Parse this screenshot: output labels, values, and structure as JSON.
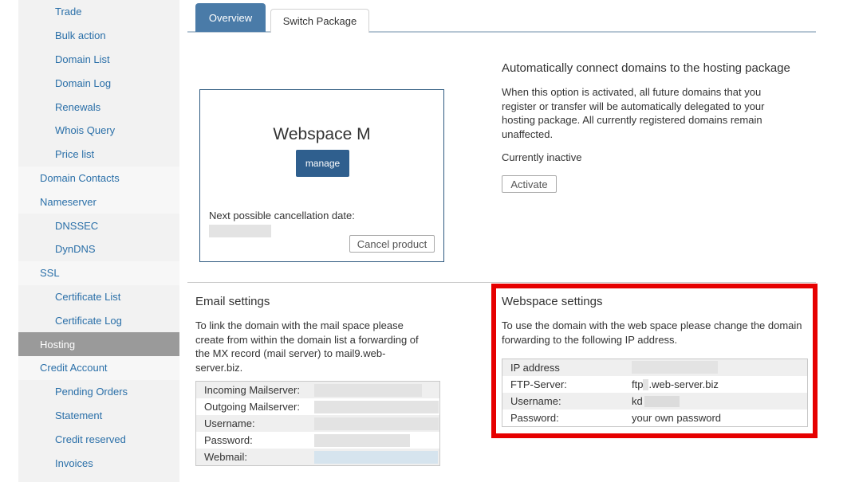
{
  "sidebar": {
    "items": [
      {
        "label": "Trade",
        "level": "sub"
      },
      {
        "label": "Bulk action",
        "level": "sub"
      },
      {
        "label": "Domain List",
        "level": "sub"
      },
      {
        "label": "Domain Log",
        "level": "sub"
      },
      {
        "label": "Renewals",
        "level": "sub"
      },
      {
        "label": "Whois Query",
        "level": "sub"
      },
      {
        "label": "Price list",
        "level": "sub"
      },
      {
        "label": "Domain Contacts",
        "level": "top"
      },
      {
        "label": "Nameserver",
        "level": "top"
      },
      {
        "label": "DNSSEC",
        "level": "sub"
      },
      {
        "label": "DynDNS",
        "level": "sub"
      },
      {
        "label": "SSL",
        "level": "top"
      },
      {
        "label": "Certificate List",
        "level": "sub"
      },
      {
        "label": "Certificate Log",
        "level": "sub"
      },
      {
        "label": "Hosting",
        "level": "active"
      },
      {
        "label": "Credit Account",
        "level": "top"
      },
      {
        "label": "Pending Orders",
        "level": "sub"
      },
      {
        "label": "Statement",
        "level": "sub"
      },
      {
        "label": "Credit reserved",
        "level": "sub"
      },
      {
        "label": "Invoices",
        "level": "sub"
      }
    ]
  },
  "tabs": {
    "overview": "Overview",
    "switch_package": "Switch Package"
  },
  "package": {
    "name": "Webspace M",
    "manage_label": "manage",
    "cancellation_label": "Next possible cancellation date:",
    "cancel_button": "Cancel product"
  },
  "auto_connect": {
    "title": "Automatically connect domains to the hosting package",
    "line1": "When this option is activated, all future domains that you",
    "line2": "register or transfer will be automatically delegated to your",
    "line3": "hosting package. All currently registered domains remain",
    "line4": "unaffected.",
    "status": "Currently inactive",
    "activate_button": "Activate"
  },
  "email": {
    "title": "Email settings",
    "line1": "To link the domain with the mail space please",
    "line2": "create from within the domain list a forwarding of",
    "line3": "the MX record (mail server) to mail9.web-",
    "line4": "server.biz.",
    "rows": {
      "incoming": "Incoming Mailserver:",
      "outgoing": "Outgoing Mailserver:",
      "username": "Username:",
      "password": "Password:",
      "webmail": "Webmail:"
    }
  },
  "webspace": {
    "title": "Webspace settings",
    "line1": "To use the domain with the web space please change the domain",
    "line2": "forwarding to the following IP address.",
    "rows": {
      "ip_label": "IP address",
      "ftp_label": "FTP-Server:",
      "ftp_prefix": "ftp",
      "ftp_suffix": ".web-server.biz",
      "user_label": "Username:",
      "user_prefix": "kd",
      "pass_label": "Password:",
      "pass_value": "your own password"
    }
  },
  "colors": {
    "accent": "#4a7ba8",
    "highlight": "#e60000",
    "link": "#2a6fa8"
  }
}
